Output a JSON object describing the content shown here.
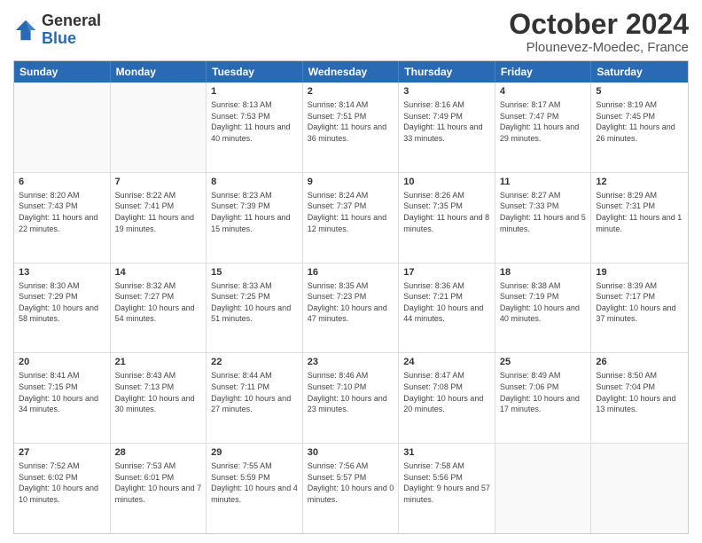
{
  "logo": {
    "general": "General",
    "blue": "Blue"
  },
  "title": "October 2024",
  "location": "Plounevez-Moedec, France",
  "headers": [
    "Sunday",
    "Monday",
    "Tuesday",
    "Wednesday",
    "Thursday",
    "Friday",
    "Saturday"
  ],
  "weeks": [
    [
      {
        "day": "",
        "sunrise": "",
        "sunset": "",
        "daylight": ""
      },
      {
        "day": "",
        "sunrise": "",
        "sunset": "",
        "daylight": ""
      },
      {
        "day": "1",
        "sunrise": "Sunrise: 8:13 AM",
        "sunset": "Sunset: 7:53 PM",
        "daylight": "Daylight: 11 hours and 40 minutes."
      },
      {
        "day": "2",
        "sunrise": "Sunrise: 8:14 AM",
        "sunset": "Sunset: 7:51 PM",
        "daylight": "Daylight: 11 hours and 36 minutes."
      },
      {
        "day": "3",
        "sunrise": "Sunrise: 8:16 AM",
        "sunset": "Sunset: 7:49 PM",
        "daylight": "Daylight: 11 hours and 33 minutes."
      },
      {
        "day": "4",
        "sunrise": "Sunrise: 8:17 AM",
        "sunset": "Sunset: 7:47 PM",
        "daylight": "Daylight: 11 hours and 29 minutes."
      },
      {
        "day": "5",
        "sunrise": "Sunrise: 8:19 AM",
        "sunset": "Sunset: 7:45 PM",
        "daylight": "Daylight: 11 hours and 26 minutes."
      }
    ],
    [
      {
        "day": "6",
        "sunrise": "Sunrise: 8:20 AM",
        "sunset": "Sunset: 7:43 PM",
        "daylight": "Daylight: 11 hours and 22 minutes."
      },
      {
        "day": "7",
        "sunrise": "Sunrise: 8:22 AM",
        "sunset": "Sunset: 7:41 PM",
        "daylight": "Daylight: 11 hours and 19 minutes."
      },
      {
        "day": "8",
        "sunrise": "Sunrise: 8:23 AM",
        "sunset": "Sunset: 7:39 PM",
        "daylight": "Daylight: 11 hours and 15 minutes."
      },
      {
        "day": "9",
        "sunrise": "Sunrise: 8:24 AM",
        "sunset": "Sunset: 7:37 PM",
        "daylight": "Daylight: 11 hours and 12 minutes."
      },
      {
        "day": "10",
        "sunrise": "Sunrise: 8:26 AM",
        "sunset": "Sunset: 7:35 PM",
        "daylight": "Daylight: 11 hours and 8 minutes."
      },
      {
        "day": "11",
        "sunrise": "Sunrise: 8:27 AM",
        "sunset": "Sunset: 7:33 PM",
        "daylight": "Daylight: 11 hours and 5 minutes."
      },
      {
        "day": "12",
        "sunrise": "Sunrise: 8:29 AM",
        "sunset": "Sunset: 7:31 PM",
        "daylight": "Daylight: 11 hours and 1 minute."
      }
    ],
    [
      {
        "day": "13",
        "sunrise": "Sunrise: 8:30 AM",
        "sunset": "Sunset: 7:29 PM",
        "daylight": "Daylight: 10 hours and 58 minutes."
      },
      {
        "day": "14",
        "sunrise": "Sunrise: 8:32 AM",
        "sunset": "Sunset: 7:27 PM",
        "daylight": "Daylight: 10 hours and 54 minutes."
      },
      {
        "day": "15",
        "sunrise": "Sunrise: 8:33 AM",
        "sunset": "Sunset: 7:25 PM",
        "daylight": "Daylight: 10 hours and 51 minutes."
      },
      {
        "day": "16",
        "sunrise": "Sunrise: 8:35 AM",
        "sunset": "Sunset: 7:23 PM",
        "daylight": "Daylight: 10 hours and 47 minutes."
      },
      {
        "day": "17",
        "sunrise": "Sunrise: 8:36 AM",
        "sunset": "Sunset: 7:21 PM",
        "daylight": "Daylight: 10 hours and 44 minutes."
      },
      {
        "day": "18",
        "sunrise": "Sunrise: 8:38 AM",
        "sunset": "Sunset: 7:19 PM",
        "daylight": "Daylight: 10 hours and 40 minutes."
      },
      {
        "day": "19",
        "sunrise": "Sunrise: 8:39 AM",
        "sunset": "Sunset: 7:17 PM",
        "daylight": "Daylight: 10 hours and 37 minutes."
      }
    ],
    [
      {
        "day": "20",
        "sunrise": "Sunrise: 8:41 AM",
        "sunset": "Sunset: 7:15 PM",
        "daylight": "Daylight: 10 hours and 34 minutes."
      },
      {
        "day": "21",
        "sunrise": "Sunrise: 8:43 AM",
        "sunset": "Sunset: 7:13 PM",
        "daylight": "Daylight: 10 hours and 30 minutes."
      },
      {
        "day": "22",
        "sunrise": "Sunrise: 8:44 AM",
        "sunset": "Sunset: 7:11 PM",
        "daylight": "Daylight: 10 hours and 27 minutes."
      },
      {
        "day": "23",
        "sunrise": "Sunrise: 8:46 AM",
        "sunset": "Sunset: 7:10 PM",
        "daylight": "Daylight: 10 hours and 23 minutes."
      },
      {
        "day": "24",
        "sunrise": "Sunrise: 8:47 AM",
        "sunset": "Sunset: 7:08 PM",
        "daylight": "Daylight: 10 hours and 20 minutes."
      },
      {
        "day": "25",
        "sunrise": "Sunrise: 8:49 AM",
        "sunset": "Sunset: 7:06 PM",
        "daylight": "Daylight: 10 hours and 17 minutes."
      },
      {
        "day": "26",
        "sunrise": "Sunrise: 8:50 AM",
        "sunset": "Sunset: 7:04 PM",
        "daylight": "Daylight: 10 hours and 13 minutes."
      }
    ],
    [
      {
        "day": "27",
        "sunrise": "Sunrise: 7:52 AM",
        "sunset": "Sunset: 6:02 PM",
        "daylight": "Daylight: 10 hours and 10 minutes."
      },
      {
        "day": "28",
        "sunrise": "Sunrise: 7:53 AM",
        "sunset": "Sunset: 6:01 PM",
        "daylight": "Daylight: 10 hours and 7 minutes."
      },
      {
        "day": "29",
        "sunrise": "Sunrise: 7:55 AM",
        "sunset": "Sunset: 5:59 PM",
        "daylight": "Daylight: 10 hours and 4 minutes."
      },
      {
        "day": "30",
        "sunrise": "Sunrise: 7:56 AM",
        "sunset": "Sunset: 5:57 PM",
        "daylight": "Daylight: 10 hours and 0 minutes."
      },
      {
        "day": "31",
        "sunrise": "Sunrise: 7:58 AM",
        "sunset": "Sunset: 5:56 PM",
        "daylight": "Daylight: 9 hours and 57 minutes."
      },
      {
        "day": "",
        "sunrise": "",
        "sunset": "",
        "daylight": ""
      },
      {
        "day": "",
        "sunrise": "",
        "sunset": "",
        "daylight": ""
      }
    ]
  ]
}
